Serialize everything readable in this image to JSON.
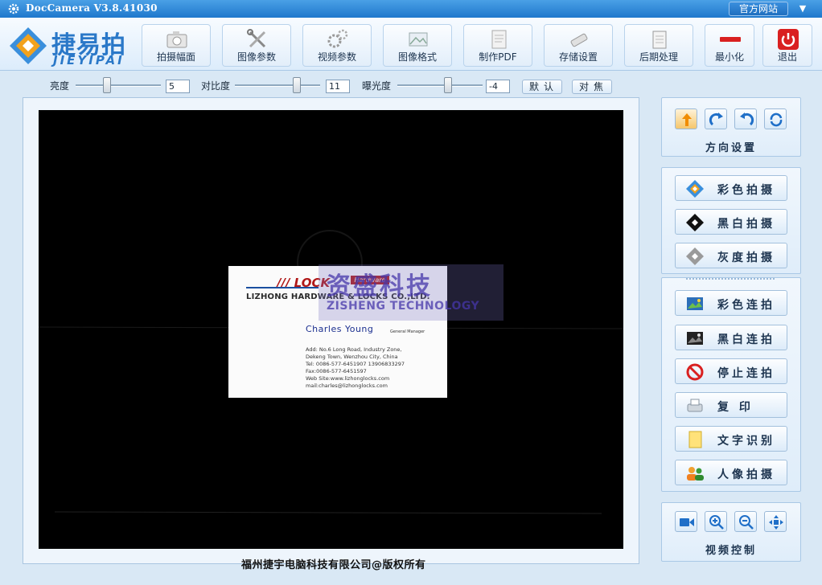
{
  "app": {
    "title": "DocCamera V3.8.41030",
    "website_label": "官方网站"
  },
  "logo": {
    "cn": "捷易拍",
    "en": "JIEYIPAI"
  },
  "toolbar": [
    {
      "name": "capture-size-button",
      "label": "拍摄幅面",
      "icon": "camera-icon"
    },
    {
      "name": "image-params-button",
      "label": "图像参数",
      "icon": "tools-icon"
    },
    {
      "name": "video-params-button",
      "label": "视频参数",
      "icon": "gears-icon"
    },
    {
      "name": "image-format-button",
      "label": "图像格式",
      "icon": "image-icon"
    },
    {
      "name": "make-pdf-button",
      "label": "制作PDF",
      "icon": "pdf-icon"
    },
    {
      "name": "storage-settings-button",
      "label": "存储设置",
      "icon": "usb-icon"
    },
    {
      "name": "post-processing-button",
      "label": "后期处理",
      "icon": "notepad-icon"
    },
    {
      "name": "minimize-button",
      "label": "最小化",
      "icon": "minimize-icon"
    },
    {
      "name": "exit-button",
      "label": "退出",
      "icon": "power-icon"
    }
  ],
  "controls": {
    "brightness": {
      "label": "亮度",
      "value": "5",
      "level": 0.35
    },
    "contrast": {
      "label": "对比度",
      "value": "11",
      "level": 0.75
    },
    "exposure": {
      "label": "曝光度",
      "value": "-4",
      "level": 0.6
    },
    "default_label": "默认",
    "focus_label": "对焦"
  },
  "preview": {
    "card": {
      "logo_text": "LOCK",
      "logo_badge": "Hardware",
      "company": "LIZHONG HARDWARE & LOCKS CO.,LTD.",
      "person": "Charles Young",
      "role": "General Manager",
      "lines": [
        "Add: No.6 Long Road, Industry Zone,",
        "Dekeng Town, Wenzhou City, China",
        "Tel: 0086-577-6451907  13906833297",
        "Fax:0086-577-6451597",
        "Web Site:www.lizhonglocks.com",
        "mail:charles@lizhonglocks.com"
      ]
    },
    "watermark": {
      "cn": "资盛科技",
      "en": "ZISHENG TECHNOLOGY"
    }
  },
  "copyright": "福州捷宇电脑科技有限公司@版权所有",
  "direction_panel": {
    "title": "方向设置",
    "buttons": [
      {
        "name": "rotate-up-button",
        "icon": "arrow-up-icon"
      },
      {
        "name": "rotate-right-button",
        "icon": "rotate-cw-icon"
      },
      {
        "name": "rotate-left-button",
        "icon": "rotate-ccw-icon"
      },
      {
        "name": "rotate-180-button",
        "icon": "rotate-180-icon"
      }
    ]
  },
  "capture_panel": [
    {
      "name": "color-capture-button",
      "label": "彩色拍摄",
      "icon": "color-diamond-icon"
    },
    {
      "name": "bw-capture-button",
      "label": "黑白拍摄",
      "icon": "black-diamond-icon"
    },
    {
      "name": "gray-capture-button",
      "label": "灰度拍摄",
      "icon": "gray-diamond-icon"
    }
  ],
  "continuous_panel": [
    {
      "name": "color-burst-button",
      "label": "彩色连拍",
      "icon": "color-photo-icon"
    },
    {
      "name": "bw-burst-button",
      "label": "黑白连拍",
      "icon": "bw-photo-icon"
    },
    {
      "name": "stop-burst-button",
      "label": "停止连拍",
      "icon": "stop-icon"
    },
    {
      "name": "copy-button",
      "label": "复  印",
      "icon": "printer-icon"
    },
    {
      "name": "ocr-button",
      "label": "文字识别",
      "icon": "note-icon"
    },
    {
      "name": "portrait-capture-button",
      "label": "人像拍摄",
      "icon": "people-icon"
    }
  ],
  "video_panel": {
    "title": "视频控制",
    "buttons": [
      {
        "name": "video-record-button",
        "icon": "video-camera-icon"
      },
      {
        "name": "zoom-in-button",
        "icon": "zoom-in-icon"
      },
      {
        "name": "zoom-out-button",
        "icon": "zoom-out-icon"
      },
      {
        "name": "fit-screen-button",
        "icon": "fit-icon"
      }
    ]
  },
  "colors": {
    "titlebar": "#1f78cc",
    "accent": "#2a78c8",
    "exit_red": "#d92020"
  }
}
